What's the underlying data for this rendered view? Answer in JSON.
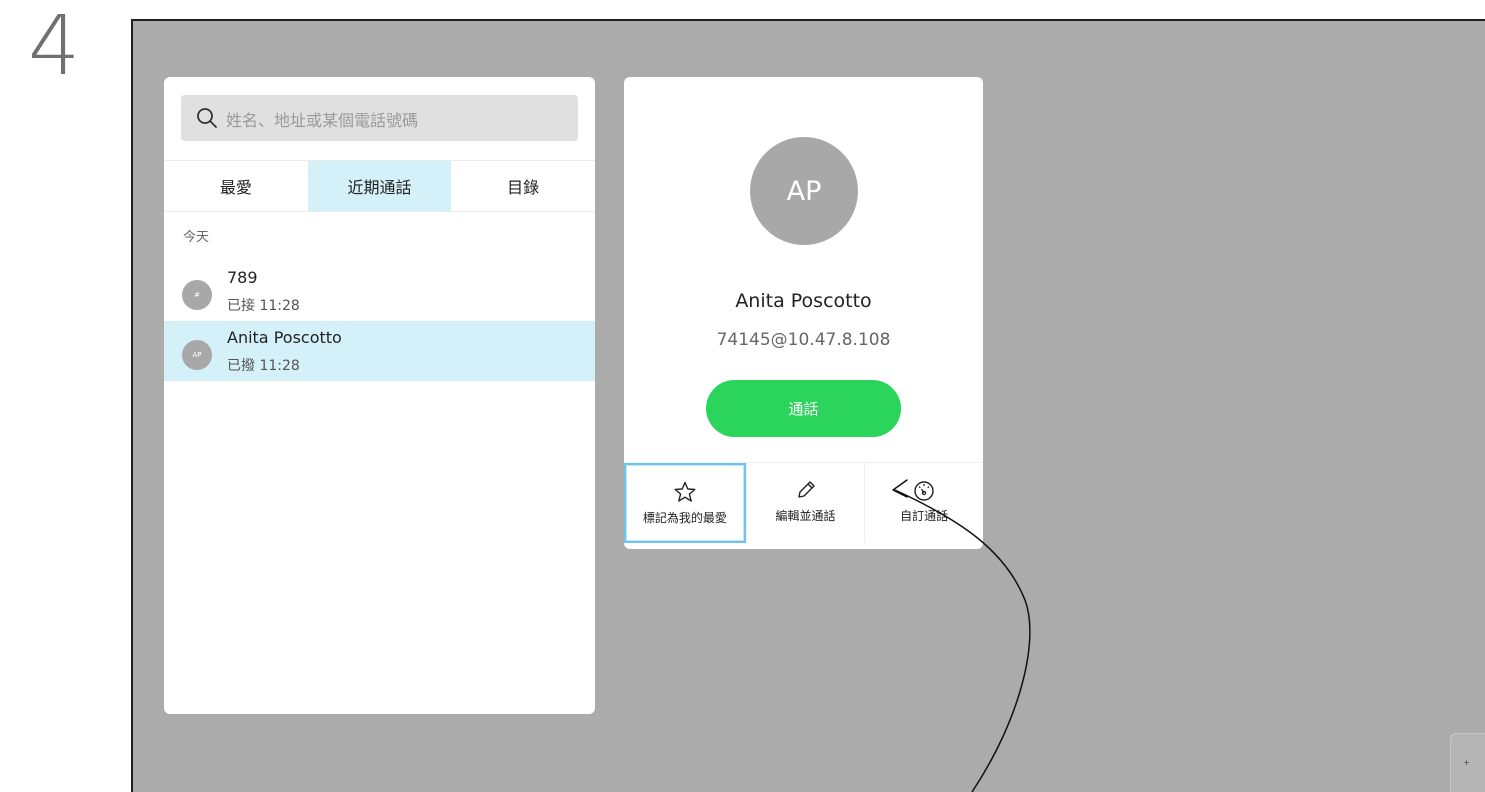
{
  "step_number": "4",
  "search": {
    "placeholder": "姓名、地址或某個電話號碼"
  },
  "tabs": [
    {
      "label": "最愛",
      "active": false
    },
    {
      "label": "近期通話",
      "active": true
    },
    {
      "label": "目錄",
      "active": false
    }
  ],
  "recent": {
    "section_label": "今天",
    "items": [
      {
        "avatar": "#",
        "name": "789",
        "detail": "已接 11:28",
        "selected": false
      },
      {
        "avatar": "AP",
        "name": "Anita Poscotto",
        "detail": "已撥 11:28",
        "selected": true
      }
    ]
  },
  "contact": {
    "initials": "AP",
    "name": "Anita Poscotto",
    "address": "74145@10.47.8.108",
    "call_label": "通話"
  },
  "actions": [
    {
      "label": "標記為我的最愛",
      "icon": "star-icon",
      "focused": true
    },
    {
      "label": "編輯並通話",
      "icon": "pencil-icon",
      "focused": false
    },
    {
      "label": "自訂通話",
      "icon": "gauge-icon",
      "focused": false
    }
  ],
  "corner_widget": {
    "text": "+"
  },
  "colors": {
    "screen_bg": "#ababab",
    "tab_active_bg": "#d4f0f8",
    "call_button": "#2bd45a",
    "focus_border": "#6dc5eb",
    "avatar": "#a8a8a8"
  }
}
